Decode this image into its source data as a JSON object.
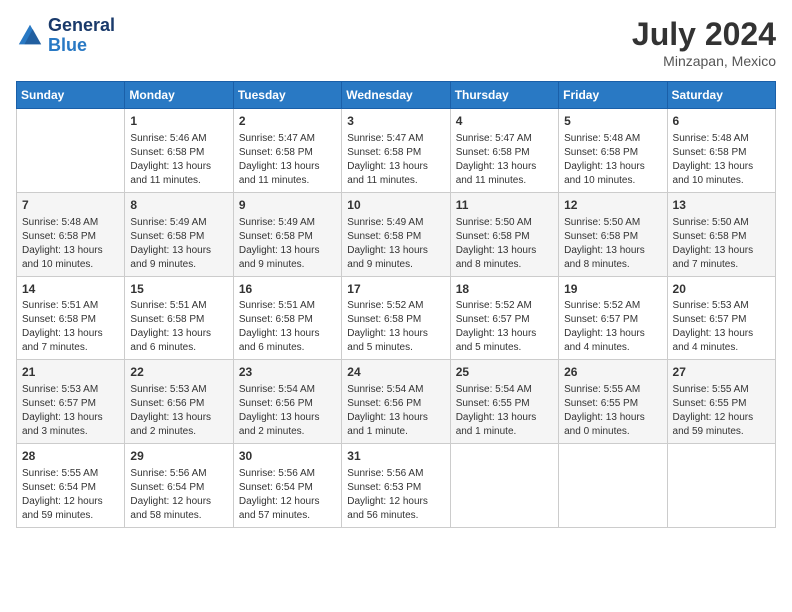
{
  "header": {
    "logo_line1": "General",
    "logo_line2": "Blue",
    "month_year": "July 2024",
    "location": "Minzapan, Mexico"
  },
  "columns": [
    "Sunday",
    "Monday",
    "Tuesday",
    "Wednesday",
    "Thursday",
    "Friday",
    "Saturday"
  ],
  "weeks": [
    [
      {
        "day": "",
        "info": ""
      },
      {
        "day": "1",
        "info": "Sunrise: 5:46 AM\nSunset: 6:58 PM\nDaylight: 13 hours\nand 11 minutes."
      },
      {
        "day": "2",
        "info": "Sunrise: 5:47 AM\nSunset: 6:58 PM\nDaylight: 13 hours\nand 11 minutes."
      },
      {
        "day": "3",
        "info": "Sunrise: 5:47 AM\nSunset: 6:58 PM\nDaylight: 13 hours\nand 11 minutes."
      },
      {
        "day": "4",
        "info": "Sunrise: 5:47 AM\nSunset: 6:58 PM\nDaylight: 13 hours\nand 11 minutes."
      },
      {
        "day": "5",
        "info": "Sunrise: 5:48 AM\nSunset: 6:58 PM\nDaylight: 13 hours\nand 10 minutes."
      },
      {
        "day": "6",
        "info": "Sunrise: 5:48 AM\nSunset: 6:58 PM\nDaylight: 13 hours\nand 10 minutes."
      }
    ],
    [
      {
        "day": "7",
        "info": "Sunrise: 5:48 AM\nSunset: 6:58 PM\nDaylight: 13 hours\nand 10 minutes."
      },
      {
        "day": "8",
        "info": "Sunrise: 5:49 AM\nSunset: 6:58 PM\nDaylight: 13 hours\nand 9 minutes."
      },
      {
        "day": "9",
        "info": "Sunrise: 5:49 AM\nSunset: 6:58 PM\nDaylight: 13 hours\nand 9 minutes."
      },
      {
        "day": "10",
        "info": "Sunrise: 5:49 AM\nSunset: 6:58 PM\nDaylight: 13 hours\nand 9 minutes."
      },
      {
        "day": "11",
        "info": "Sunrise: 5:50 AM\nSunset: 6:58 PM\nDaylight: 13 hours\nand 8 minutes."
      },
      {
        "day": "12",
        "info": "Sunrise: 5:50 AM\nSunset: 6:58 PM\nDaylight: 13 hours\nand 8 minutes."
      },
      {
        "day": "13",
        "info": "Sunrise: 5:50 AM\nSunset: 6:58 PM\nDaylight: 13 hours\nand 7 minutes."
      }
    ],
    [
      {
        "day": "14",
        "info": "Sunrise: 5:51 AM\nSunset: 6:58 PM\nDaylight: 13 hours\nand 7 minutes."
      },
      {
        "day": "15",
        "info": "Sunrise: 5:51 AM\nSunset: 6:58 PM\nDaylight: 13 hours\nand 6 minutes."
      },
      {
        "day": "16",
        "info": "Sunrise: 5:51 AM\nSunset: 6:58 PM\nDaylight: 13 hours\nand 6 minutes."
      },
      {
        "day": "17",
        "info": "Sunrise: 5:52 AM\nSunset: 6:58 PM\nDaylight: 13 hours\nand 5 minutes."
      },
      {
        "day": "18",
        "info": "Sunrise: 5:52 AM\nSunset: 6:57 PM\nDaylight: 13 hours\nand 5 minutes."
      },
      {
        "day": "19",
        "info": "Sunrise: 5:52 AM\nSunset: 6:57 PM\nDaylight: 13 hours\nand 4 minutes."
      },
      {
        "day": "20",
        "info": "Sunrise: 5:53 AM\nSunset: 6:57 PM\nDaylight: 13 hours\nand 4 minutes."
      }
    ],
    [
      {
        "day": "21",
        "info": "Sunrise: 5:53 AM\nSunset: 6:57 PM\nDaylight: 13 hours\nand 3 minutes."
      },
      {
        "day": "22",
        "info": "Sunrise: 5:53 AM\nSunset: 6:56 PM\nDaylight: 13 hours\nand 2 minutes."
      },
      {
        "day": "23",
        "info": "Sunrise: 5:54 AM\nSunset: 6:56 PM\nDaylight: 13 hours\nand 2 minutes."
      },
      {
        "day": "24",
        "info": "Sunrise: 5:54 AM\nSunset: 6:56 PM\nDaylight: 13 hours\nand 1 minute."
      },
      {
        "day": "25",
        "info": "Sunrise: 5:54 AM\nSunset: 6:55 PM\nDaylight: 13 hours\nand 1 minute."
      },
      {
        "day": "26",
        "info": "Sunrise: 5:55 AM\nSunset: 6:55 PM\nDaylight: 13 hours\nand 0 minutes."
      },
      {
        "day": "27",
        "info": "Sunrise: 5:55 AM\nSunset: 6:55 PM\nDaylight: 12 hours\nand 59 minutes."
      }
    ],
    [
      {
        "day": "28",
        "info": "Sunrise: 5:55 AM\nSunset: 6:54 PM\nDaylight: 12 hours\nand 59 minutes."
      },
      {
        "day": "29",
        "info": "Sunrise: 5:56 AM\nSunset: 6:54 PM\nDaylight: 12 hours\nand 58 minutes."
      },
      {
        "day": "30",
        "info": "Sunrise: 5:56 AM\nSunset: 6:54 PM\nDaylight: 12 hours\nand 57 minutes."
      },
      {
        "day": "31",
        "info": "Sunrise: 5:56 AM\nSunset: 6:53 PM\nDaylight: 12 hours\nand 56 minutes."
      },
      {
        "day": "",
        "info": ""
      },
      {
        "day": "",
        "info": ""
      },
      {
        "day": "",
        "info": ""
      }
    ]
  ]
}
